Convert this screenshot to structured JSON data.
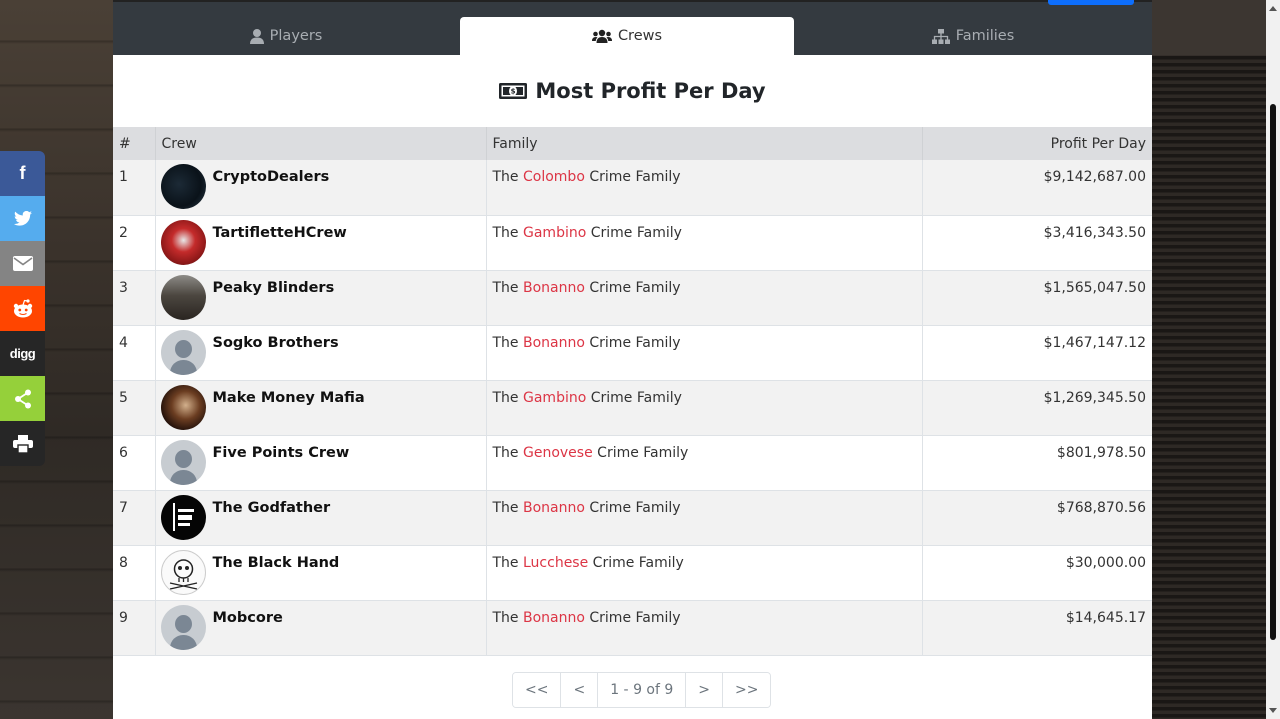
{
  "tabs": [
    {
      "label": "Players",
      "icon": "user-icon"
    },
    {
      "label": "Crews",
      "icon": "users-icon"
    },
    {
      "label": "Families",
      "icon": "sitemap-icon"
    }
  ],
  "title": "Most Profit Per Day",
  "title_icon": "money-bill-icon",
  "table": {
    "headers": [
      "#",
      "Crew",
      "Family",
      "Profit Per Day"
    ],
    "rows": [
      {
        "rank": "1",
        "crew": "CryptoDealers",
        "family_prefix": "The",
        "family": "Colombo",
        "family_suffix": "Crime Family",
        "profit": "$9,142,687.00"
      },
      {
        "rank": "2",
        "crew": "TartifletteHCrew",
        "family_prefix": "The",
        "family": "Gambino",
        "family_suffix": "Crime Family",
        "profit": "$3,416,343.50"
      },
      {
        "rank": "3",
        "crew": "Peaky Blinders",
        "family_prefix": "The",
        "family": "Bonanno",
        "family_suffix": "Crime Family",
        "profit": "$1,565,047.50"
      },
      {
        "rank": "4",
        "crew": "Sogko Brothers",
        "family_prefix": "The",
        "family": "Bonanno",
        "family_suffix": "Crime Family",
        "profit": "$1,467,147.12"
      },
      {
        "rank": "5",
        "crew": "Make Money Mafia",
        "family_prefix": "The",
        "family": "Gambino",
        "family_suffix": "Crime Family",
        "profit": "$1,269,345.50"
      },
      {
        "rank": "6",
        "crew": "Five Points Crew",
        "family_prefix": "The",
        "family": "Genovese",
        "family_suffix": "Crime Family",
        "profit": "$801,978.50"
      },
      {
        "rank": "7",
        "crew": "The Godfather",
        "family_prefix": "The",
        "family": "Bonanno",
        "family_suffix": "Crime Family",
        "profit": "$768,870.56"
      },
      {
        "rank": "8",
        "crew": "The Black Hand",
        "family_prefix": "The",
        "family": "Lucchese",
        "family_suffix": "Crime Family",
        "profit": "$30,000.00"
      },
      {
        "rank": "9",
        "crew": "Mobcore",
        "family_prefix": "The",
        "family": "Bonanno",
        "family_suffix": "Crime Family",
        "profit": "$14,645.17"
      }
    ]
  },
  "pagination": {
    "first": "<<",
    "prev": "<",
    "info": "1 - 9 of 9",
    "next": ">",
    "last": ">>"
  },
  "share": {
    "facebook": "f",
    "digg": "digg"
  },
  "colors": {
    "family_link": "#dc3545",
    "tabbar": "#343a40",
    "facebook": "#3b5998",
    "twitter": "#55acee",
    "email": "#848484",
    "reddit": "#ff4500",
    "share": "#95d03a"
  }
}
